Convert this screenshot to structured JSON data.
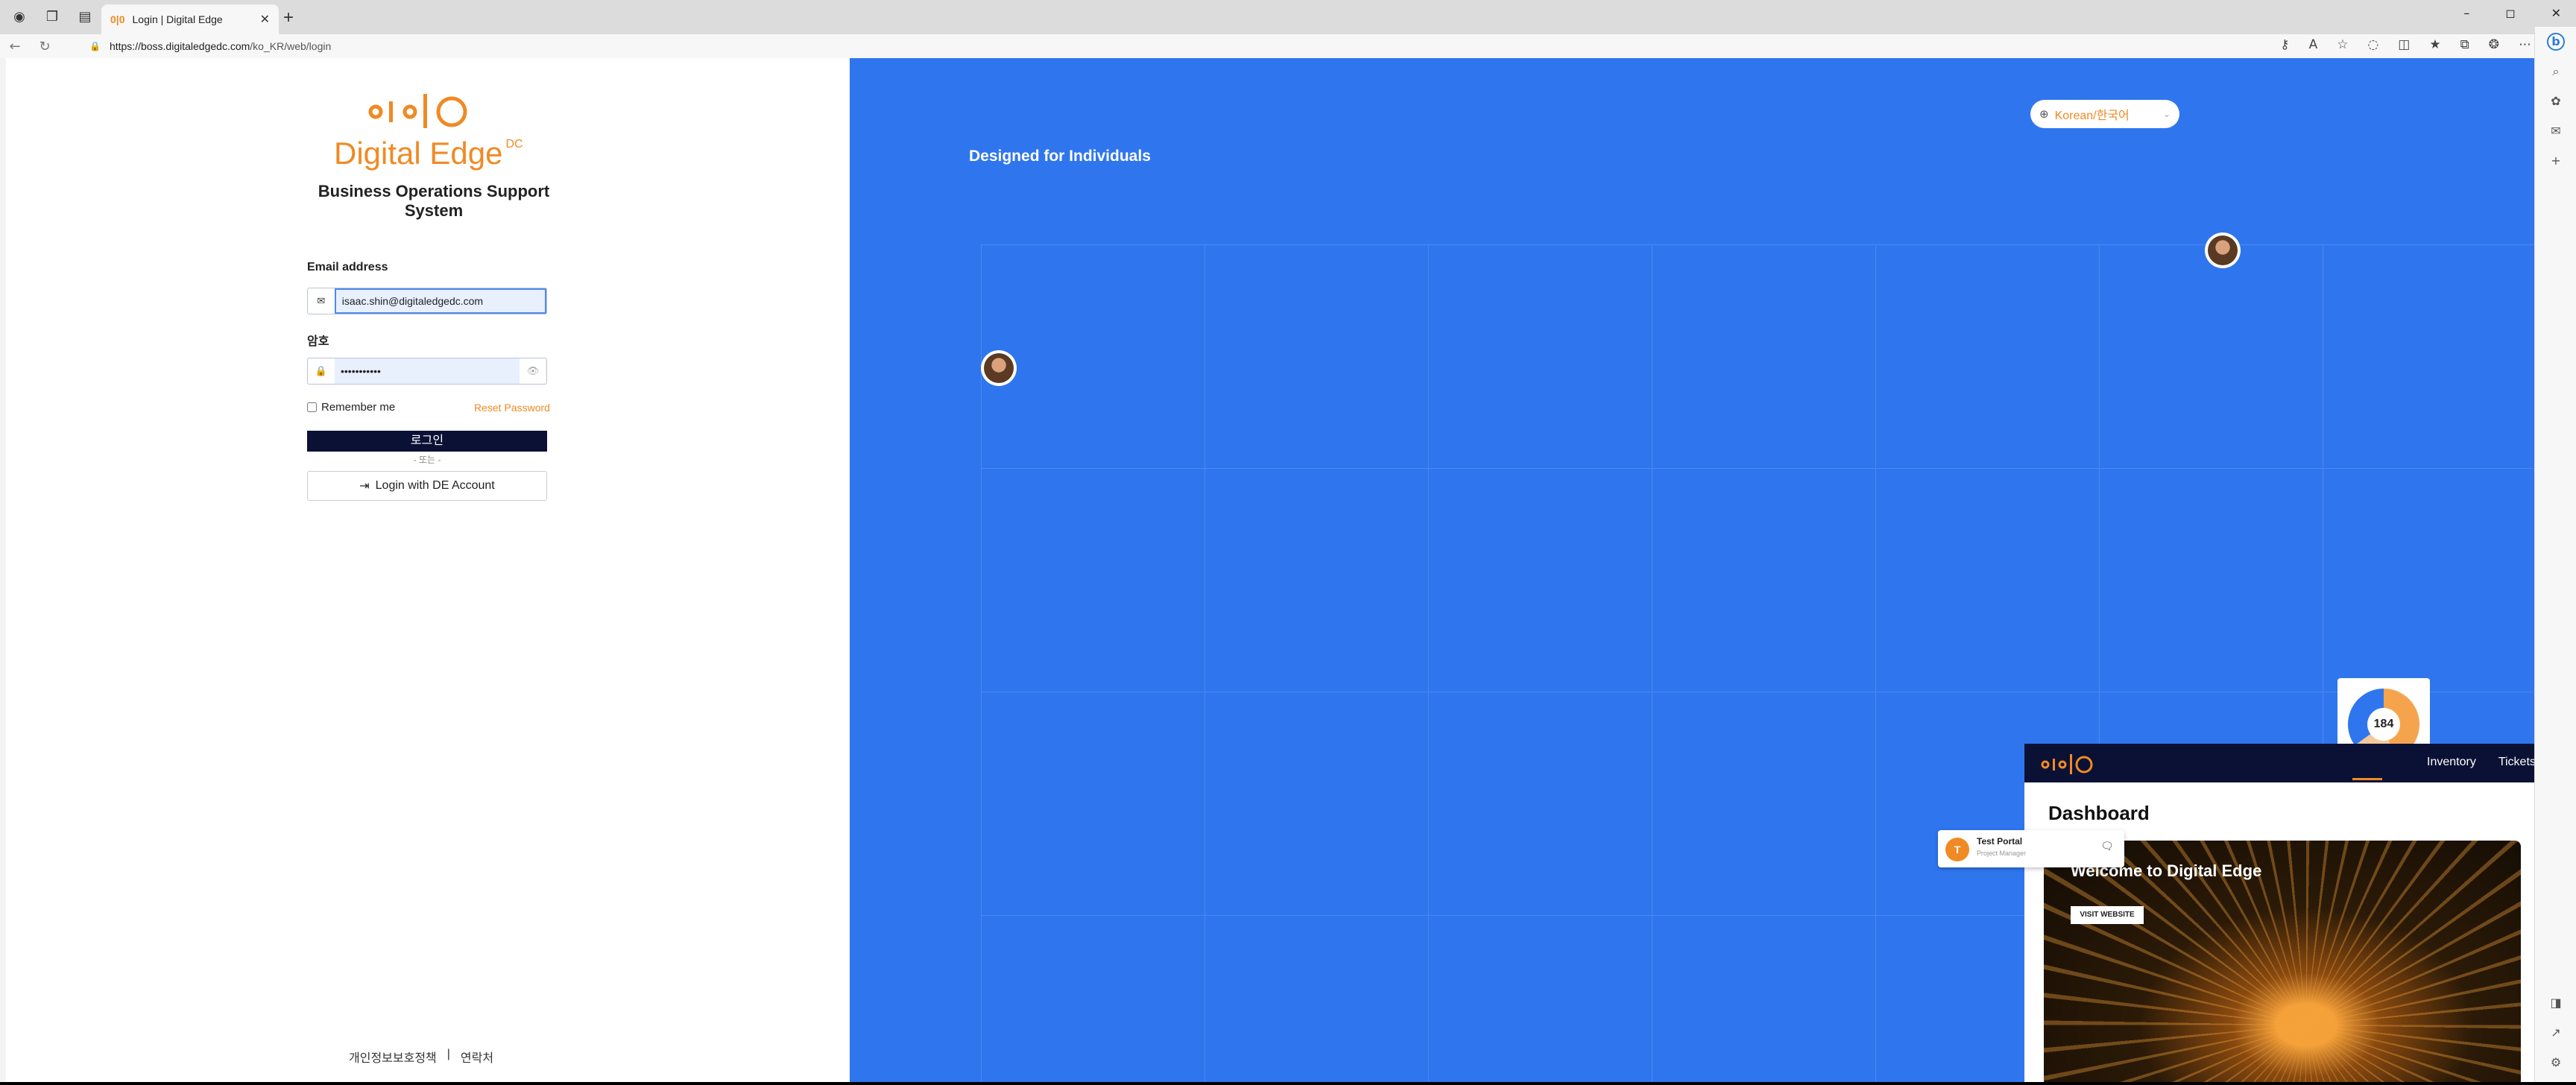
{
  "browser": {
    "tab_title": "Login | Digital Edge",
    "tab_favicon": "0|0",
    "new_tab": "+",
    "url_host": "https://boss.digitaledgedc.com",
    "url_path": "/ko_KR/web/login",
    "window_controls": [
      "–",
      "◻",
      "✕"
    ]
  },
  "login": {
    "brand_name": "Digital Edge",
    "brand_sup": "DC",
    "system_name": "Business Operations Support System",
    "email_label": "Email address",
    "email_value": "isaac.shin@digitaledgedc.com",
    "password_label": "암호",
    "password_value": "•••••••••••",
    "remember_label": "Remember me",
    "reset_label": "Reset Password",
    "login_button": "로그인",
    "or_text": "- 또는 -",
    "de_account_button": "Login with DE Account",
    "footer_privacy": "개인정보보호정책",
    "footer_sep": "|",
    "footer_contact": "연락처"
  },
  "hero_panel": {
    "tagline": "Designed for Individuals",
    "language": "Korean/한국어",
    "donut_value": "184",
    "dashboard_menu": [
      "Inventory",
      "Tickets"
    ],
    "dashboard_title": "Dashboard",
    "welcome_title": "Welcome to Digital Edge",
    "visit_button": "VISIT WEBSITE",
    "toast_name": "Test Portal",
    "toast_role": "Project Manager",
    "toast_initial": "T"
  },
  "colors": {
    "accent": "#f08a24",
    "panel_blue": "#2f76ee",
    "navy": "#0b1135"
  }
}
